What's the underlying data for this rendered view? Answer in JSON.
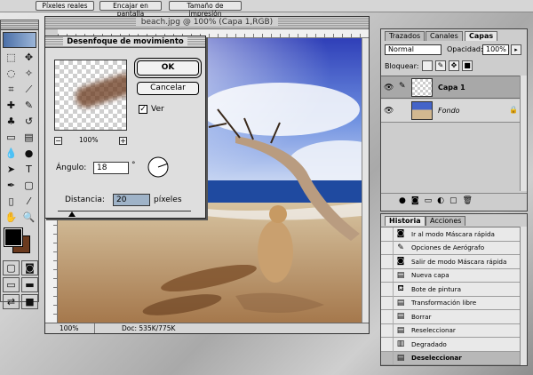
{
  "optionbar": {
    "buttons": [
      "Píxeles reales",
      "Encajar en pantalla",
      "Tamaño de impresión"
    ]
  },
  "document": {
    "title": "beach.jpg @ 100% (Capa 1,RGB)",
    "zoom": "100%",
    "doc_info": "Doc: 535K/775K"
  },
  "dialog": {
    "title": "Desenfoque de movimiento",
    "ok_label": "OK",
    "cancel_label": "Cancelar",
    "preview_label": "Ver",
    "preview_checked": true,
    "preview_zoom": "100%",
    "angle_label": "Ángulo:",
    "angle_value": "18",
    "angle_unit": "°",
    "distance_label": "Distancia:",
    "distance_value": "20",
    "distance_unit": "píxeles",
    "zoom_minus": "−",
    "zoom_plus": "+"
  },
  "layers_panel": {
    "tabs": [
      "Trazados",
      "Canales",
      "Capas"
    ],
    "active_tab": "Capas",
    "blend_mode": "Normal",
    "opacity_label": "Opacidad:",
    "opacity_value": "100%",
    "lock_label": "Bloquear:",
    "layers": [
      {
        "name": "Capa 1",
        "selected": true
      },
      {
        "name": "Fondo",
        "selected": false
      }
    ]
  },
  "history_panel": {
    "tabs": [
      "Historia",
      "Acciones"
    ],
    "active_tab": "Historia",
    "items": [
      "Ir al modo Máscara rápida",
      "Opciones de Aerógrafo",
      "Salir de modo Máscara rápida",
      "Nueva capa",
      "Bote de pintura",
      "Transformación libre",
      "Borrar",
      "Reseleccionar",
      "Degradado",
      "Deseleccionar"
    ],
    "selected_item": "Deseleccionar"
  },
  "colors": {
    "foreground": "#000000",
    "background": "#6b3a1e",
    "selection": "#b8b8b8"
  }
}
